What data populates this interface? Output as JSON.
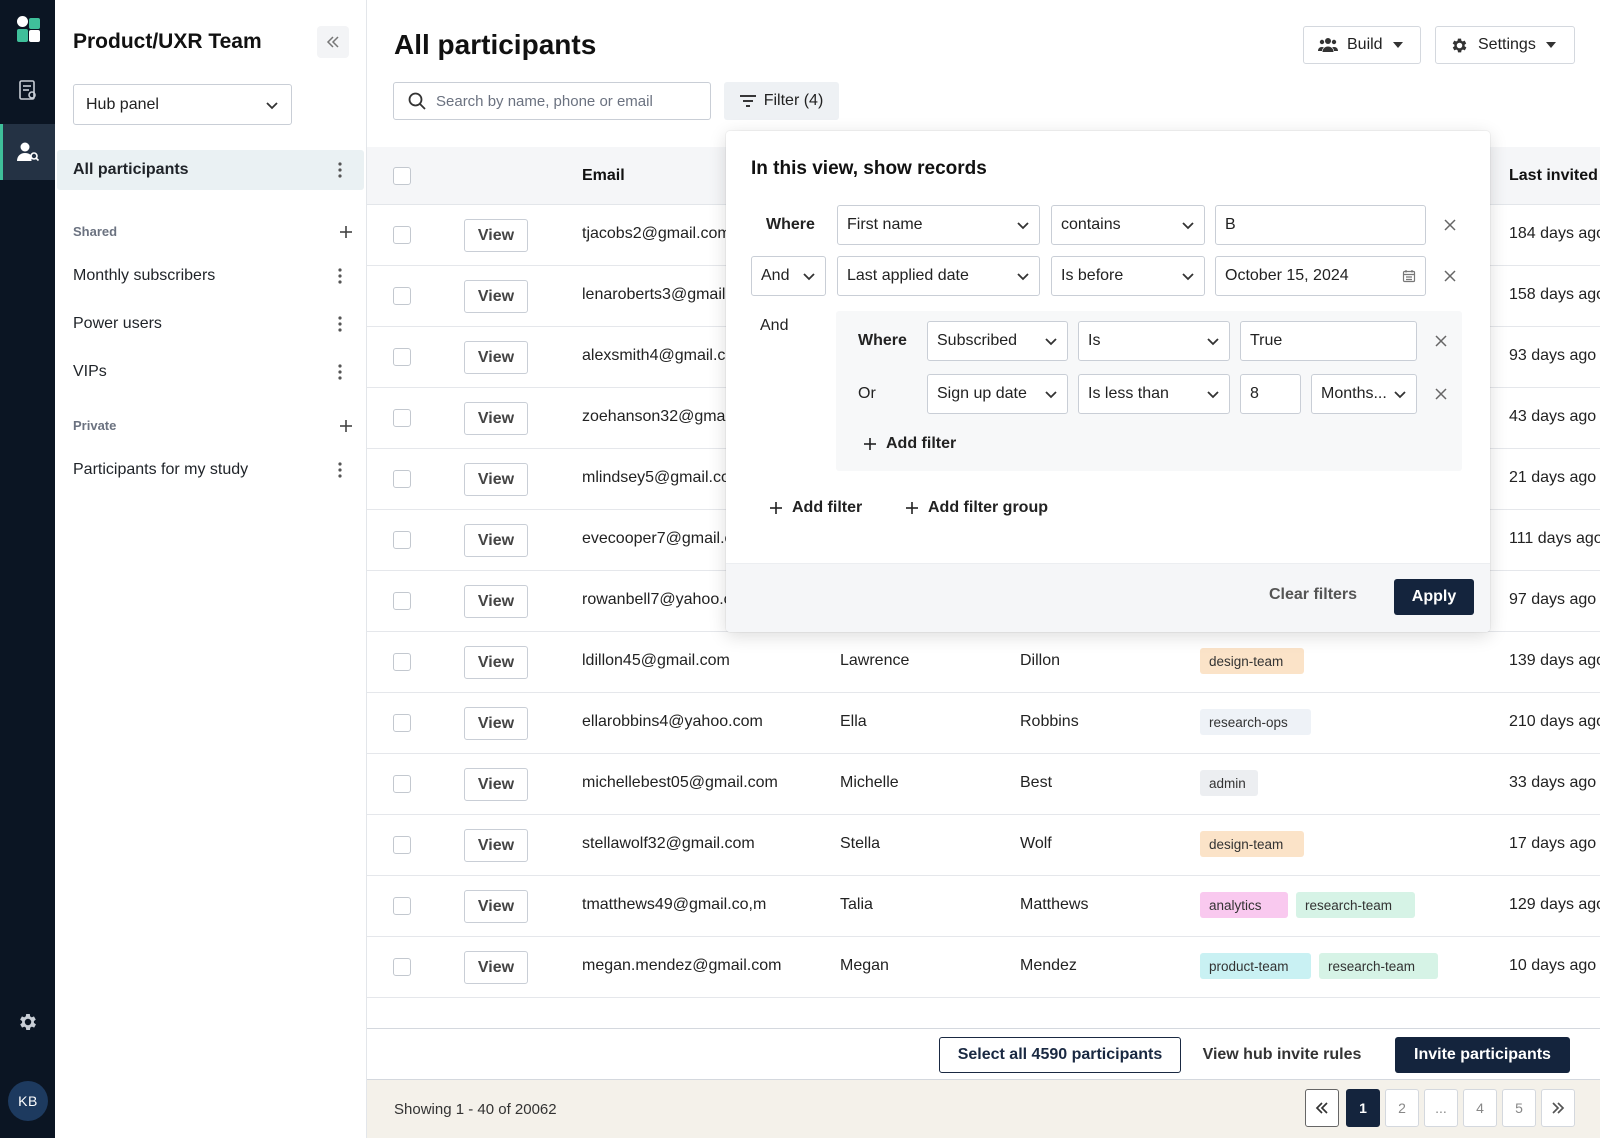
{
  "rail": {
    "avatar_initials": "KB",
    "accent": "#3fbf9a"
  },
  "panel": {
    "team_title": "Product/UXR Team",
    "hub_select": "Hub panel",
    "all_participants": "All participants",
    "shared_label": "Shared",
    "shared_items": [
      "Monthly subscribers",
      "Power users",
      "VIPs"
    ],
    "private_label": "Private",
    "private_items": [
      "Participants for my study"
    ]
  },
  "header": {
    "title": "All participants",
    "build_label": "Build",
    "settings_label": "Settings",
    "search_placeholder": "Search by name, phone or email",
    "filter_label": "Filter (4)"
  },
  "table": {
    "columns": {
      "email": "Email",
      "last_invited": "Last invited"
    },
    "view_label": "View",
    "rows": [
      {
        "email": "tjacobs2@gmail.com",
        "first": "",
        "last": "",
        "tags": [],
        "last_invited": "184 days ago"
      },
      {
        "email": "lenaroberts3@gmail.com",
        "first": "",
        "last": "",
        "tags": [],
        "last_invited": "158 days ago"
      },
      {
        "email": "alexsmith4@gmail.com",
        "first": "",
        "last": "",
        "tags": [],
        "last_invited": "93 days ago"
      },
      {
        "email": "zoehanson32@gmail.com",
        "first": "",
        "last": "",
        "tags": [],
        "last_invited": "43 days ago"
      },
      {
        "email": "mlindsey5@gmail.com",
        "first": "",
        "last": "",
        "tags": [],
        "last_invited": "21 days ago"
      },
      {
        "email": "evecooper7@gmail.com",
        "first": "",
        "last": "",
        "tags": [],
        "last_invited": "111 days ago"
      },
      {
        "email": "rowanbell7@yahoo.com",
        "first": "",
        "last": "",
        "tags": [],
        "last_invited": "97 days ago"
      },
      {
        "email": "ldillon45@gmail.com",
        "first": "Lawrence",
        "last": "Dillon",
        "tags": [
          {
            "label": "design-team",
            "color": "#fbe3c8"
          }
        ],
        "last_invited": "139 days ago"
      },
      {
        "email": "ellarobbins4@yahoo.com",
        "first": "Ella",
        "last": "Robbins",
        "tags": [
          {
            "label": "research-ops",
            "color": "#eef2f7"
          }
        ],
        "last_invited": "210 days ago"
      },
      {
        "email": "michellebest05@gmail.com",
        "first": "Michelle",
        "last": "Best",
        "tags": [
          {
            "label": "admin",
            "color": "#eceef1"
          }
        ],
        "last_invited": "33 days ago"
      },
      {
        "email": "stellawolf32@gmail.com",
        "first": "Stella",
        "last": "Wolf",
        "tags": [
          {
            "label": "design-team",
            "color": "#fbe3c8"
          }
        ],
        "last_invited": "17 days ago"
      },
      {
        "email": "tmatthews49@gmail.co,m",
        "first": "Talia",
        "last": "Matthews",
        "tags": [
          {
            "label": "analytics",
            "color": "#f9c9ef"
          },
          {
            "label": "research-team",
            "color": "#d6f3e6"
          }
        ],
        "last_invited": "129 days ago"
      },
      {
        "email": "megan.mendez@gmail.com",
        "first": "Megan",
        "last": "Mendez",
        "tags": [
          {
            "label": "product-team",
            "color": "#c9f1f3"
          },
          {
            "label": "research-team",
            "color": "#d6f3e6"
          }
        ],
        "last_invited": "10 days ago"
      }
    ]
  },
  "filter_popover": {
    "title": "In this view, show records",
    "where_label": "Where",
    "row1": {
      "field": "First name",
      "operator": "contains",
      "value": "B"
    },
    "row2": {
      "join": "And",
      "field": "Last applied date",
      "operator": "Is before",
      "value": "October 15, 2024"
    },
    "group_join": "And",
    "group": {
      "where_label": "Where",
      "row1": {
        "field": "Subscribed",
        "operator": "Is",
        "value": "True"
      },
      "row2": {
        "join": "Or",
        "field": "Sign up date",
        "operator": "Is less than",
        "value": "8",
        "unit": "Months..."
      },
      "add_filter": "Add filter"
    },
    "add_filter": "Add filter",
    "add_filter_group": "Add filter group",
    "clear_filters": "Clear filters",
    "apply": "Apply"
  },
  "actions": {
    "select_all": "Select all 4590 participants",
    "hub_rules": "View hub invite rules",
    "invite": "Invite participants"
  },
  "pagination": {
    "showing": "Showing 1 - 40 of 20062",
    "pages": [
      "1",
      "2",
      "...",
      "4",
      "5"
    ],
    "current": "1"
  },
  "colors": {
    "navy": "#14243d",
    "rail": "#0b1523"
  }
}
